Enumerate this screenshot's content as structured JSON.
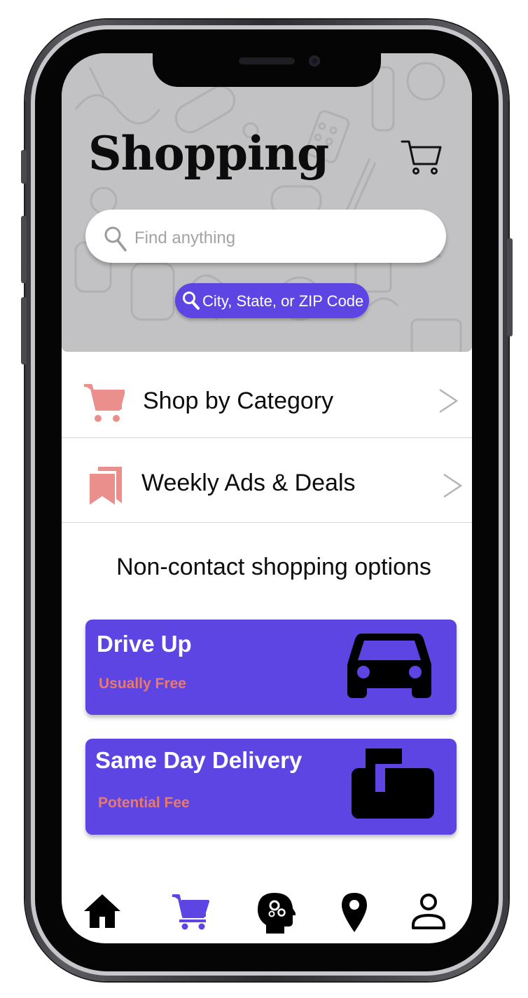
{
  "header": {
    "title": "Shopping",
    "cart_icon": "shopping-cart-icon",
    "search": {
      "placeholder": "Find anything",
      "value": ""
    },
    "location_button_label": "City, State, or ZIP Code"
  },
  "menu": [
    {
      "label": "Shop by Category",
      "icon": "shopping-cart-icon",
      "icon_color": "#ea8f8b"
    },
    {
      "label": "Weekly Ads & Deals",
      "icon": "bookmarks-icon",
      "icon_color": "#ea8f8b"
    }
  ],
  "section": {
    "title": "Non-contact shopping options"
  },
  "options": [
    {
      "title": "Drive Up",
      "subtitle": "Usually Free",
      "icon": "car-icon"
    },
    {
      "title": "Same Day Delivery",
      "subtitle": "Potential Fee",
      "icon": "mailbox-icon"
    }
  ],
  "bottom_nav": [
    {
      "name": "home",
      "icon": "home-icon",
      "active": false
    },
    {
      "name": "shop",
      "icon": "shopping-cart-icon",
      "active": true
    },
    {
      "name": "wellness",
      "icon": "head-gears-icon",
      "active": false
    },
    {
      "name": "locations",
      "icon": "location-pin-icon",
      "active": false
    },
    {
      "name": "account",
      "icon": "person-icon",
      "active": false
    }
  ],
  "colors": {
    "accent": "#5d45e4",
    "subtitle": "#e97a6b",
    "menu_icon": "#ea8f8b",
    "header_bg": "#c2c2c4"
  }
}
